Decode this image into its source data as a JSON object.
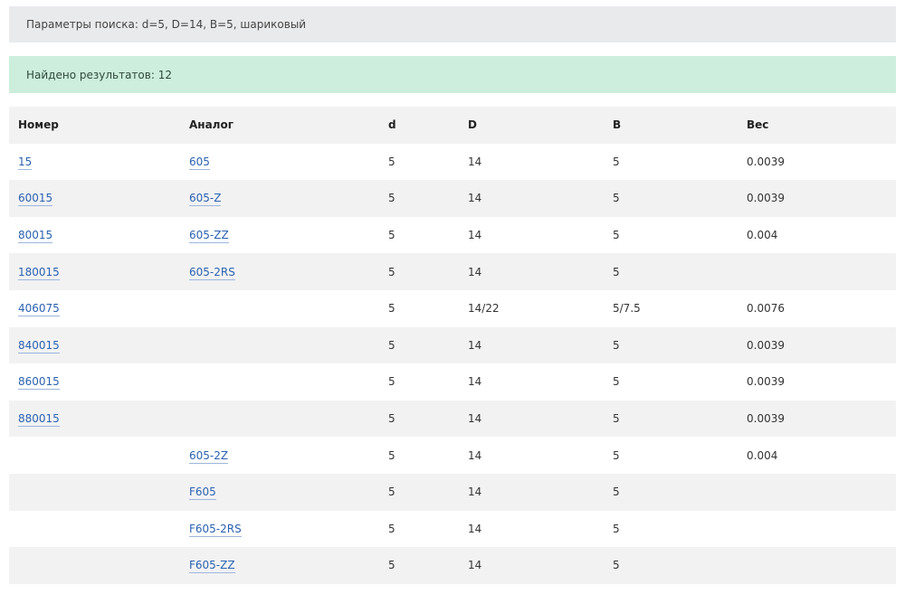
{
  "search_params": {
    "text": "Параметры поиска:  d=5,  D=14,  B=5,  шариковый"
  },
  "results_summary": {
    "text": "Найдено результатов: 12"
  },
  "table": {
    "headers": [
      "Номер",
      "Аналог",
      "d",
      "D",
      "B",
      "Вес"
    ],
    "rows": [
      {
        "number": "15",
        "analog": "605",
        "d": "5",
        "D": "14",
        "B": "5",
        "weight": "0.0039"
      },
      {
        "number": "60015",
        "analog": "605-Z",
        "d": "5",
        "D": "14",
        "B": "5",
        "weight": "0.0039"
      },
      {
        "number": "80015",
        "analog": "605-ZZ",
        "d": "5",
        "D": "14",
        "B": "5",
        "weight": "0.004"
      },
      {
        "number": "180015",
        "analog": "605-2RS",
        "d": "5",
        "D": "14",
        "B": "5",
        "weight": ""
      },
      {
        "number": "406075",
        "analog": "",
        "d": "5",
        "D": "14/22",
        "B": "5/7.5",
        "weight": "0.0076"
      },
      {
        "number": "840015",
        "analog": "",
        "d": "5",
        "D": "14",
        "B": "5",
        "weight": "0.0039"
      },
      {
        "number": "860015",
        "analog": "",
        "d": "5",
        "D": "14",
        "B": "5",
        "weight": "0.0039"
      },
      {
        "number": "880015",
        "analog": "",
        "d": "5",
        "D": "14",
        "B": "5",
        "weight": "0.0039"
      },
      {
        "number": "",
        "analog": "605-2Z",
        "d": "5",
        "D": "14",
        "B": "5",
        "weight": "0.004"
      },
      {
        "number": "",
        "analog": "F605",
        "d": "5",
        "D": "14",
        "B": "5",
        "weight": ""
      },
      {
        "number": "",
        "analog": "F605-2RS",
        "d": "5",
        "D": "14",
        "B": "5",
        "weight": ""
      },
      {
        "number": "",
        "analog": "F605-ZZ",
        "d": "5",
        "D": "14",
        "B": "5",
        "weight": ""
      }
    ]
  },
  "colors": {
    "link": "#2a62b0",
    "params_bg": "#e9eaec",
    "results_bg": "#cdeedc",
    "row_stripe": "#f2f2f3"
  }
}
